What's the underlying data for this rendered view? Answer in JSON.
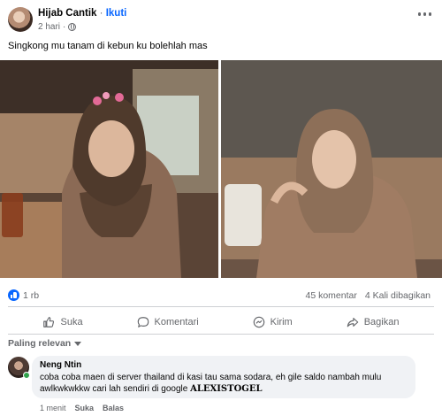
{
  "post": {
    "author": "Hijab Cantik",
    "separator": "·",
    "follow_label": "Ikuti",
    "time": "2 hari",
    "caption": "Singkong mu tanam di kebun ku bolehlah mas"
  },
  "stats": {
    "likes": "1 rb",
    "comments": "45 komentar",
    "shares": "4 Kali dibagikan"
  },
  "actions": {
    "like": "Suka",
    "comment": "Komentari",
    "send": "Kirim",
    "share": "Bagikan"
  },
  "comments_section": {
    "sort_label": "Paling relevan",
    "items": [
      {
        "name": "Neng Ntin",
        "text_line1": "coba coba maen di server thailand di kasi tau sama sodara, eh gile saldo nambah mulu",
        "text_line2": "awlkwkwkkw cari lah sendiri di google",
        "brand": "ALEXISTOGEL",
        "time": "1 menit",
        "like": "Suka",
        "reply": "Balas"
      }
    ]
  },
  "colors": {
    "accent": "#0866ff",
    "muted": "#65676b",
    "bubble": "#f0f2f5",
    "online": "#31a24c"
  },
  "icons": [
    "globe-icon",
    "more-icon",
    "like-icon",
    "thumb-icon",
    "comment-icon",
    "send-icon",
    "share-icon",
    "caret-icon"
  ]
}
